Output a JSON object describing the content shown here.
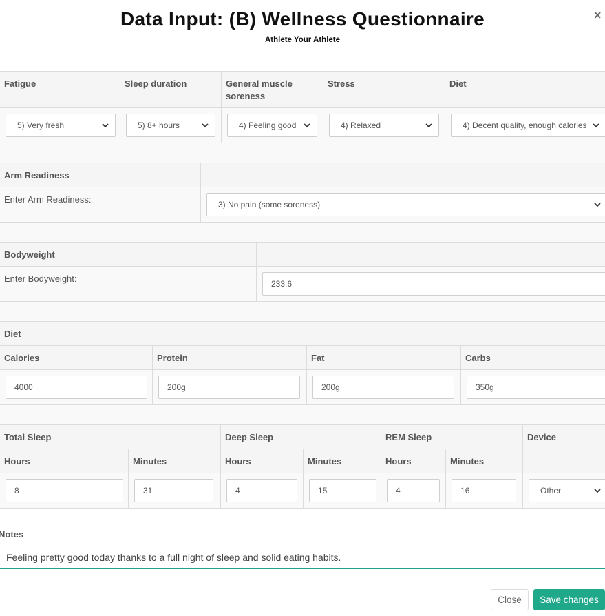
{
  "modal": {
    "title": "Data Input: (B) Wellness Questionnaire",
    "subtitle": "Athlete Your Athlete",
    "close_glyph": "×"
  },
  "wellness": {
    "headers": [
      "Fatigue",
      "Sleep duration",
      "General muscle soreness",
      "Stress",
      "Diet"
    ],
    "values": [
      "5) Very fresh",
      "5) 8+ hours",
      "4) Feeling good",
      "4) Relaxed",
      "4) Decent quality, enough calories"
    ]
  },
  "arm_readiness": {
    "header": "Arm Readiness",
    "label": "Enter Arm Readiness:",
    "value": "3) No pain (some soreness)"
  },
  "bodyweight": {
    "header": "Bodyweight",
    "label": "Enter Bodyweight:",
    "value": "233.6"
  },
  "diet": {
    "header": "Diet",
    "columns": [
      "Calories",
      "Protein",
      "Fat",
      "Carbs"
    ],
    "values": [
      "4000",
      "200g",
      "200g",
      "350g"
    ]
  },
  "sleep": {
    "groups": [
      "Total Sleep",
      "Deep Sleep",
      "REM Sleep",
      "Device"
    ],
    "subheaders": [
      "Hours",
      "Minutes",
      "Hours",
      "Minutes",
      "Hours",
      "Minutes"
    ],
    "values": [
      "8",
      "31",
      "4",
      "15",
      "4",
      "16"
    ],
    "device": "Other"
  },
  "notes": {
    "label": "Notes",
    "value": "Feeling pretty good today thanks to a full night of sleep and solid eating habits."
  },
  "footer": {
    "close_label": "Close",
    "save_label": "Save changes"
  },
  "colors": {
    "accent": "#1fa88a"
  }
}
